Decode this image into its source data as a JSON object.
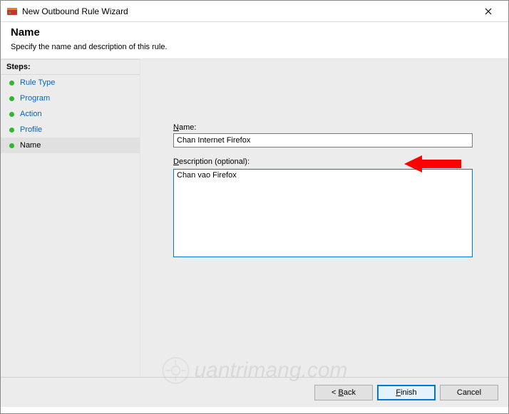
{
  "window": {
    "title": "New Outbound Rule Wizard"
  },
  "header": {
    "title": "Name",
    "subtitle": "Specify the name and description of this rule."
  },
  "sidebar": {
    "stepsHeader": "Steps:",
    "items": [
      {
        "label": "Rule Type"
      },
      {
        "label": "Program"
      },
      {
        "label": "Action"
      },
      {
        "label": "Profile"
      },
      {
        "label": "Name"
      }
    ],
    "currentIndex": 4
  },
  "form": {
    "nameLabel": "Name:",
    "nameValue": "Chan Internet Firefox",
    "descLabel": "Description (optional):",
    "descValue": "Chan vao Firefox"
  },
  "buttons": {
    "back": "< Back",
    "finish": "Finish",
    "cancel": "Cancel"
  },
  "watermark": "uantrimang.com"
}
